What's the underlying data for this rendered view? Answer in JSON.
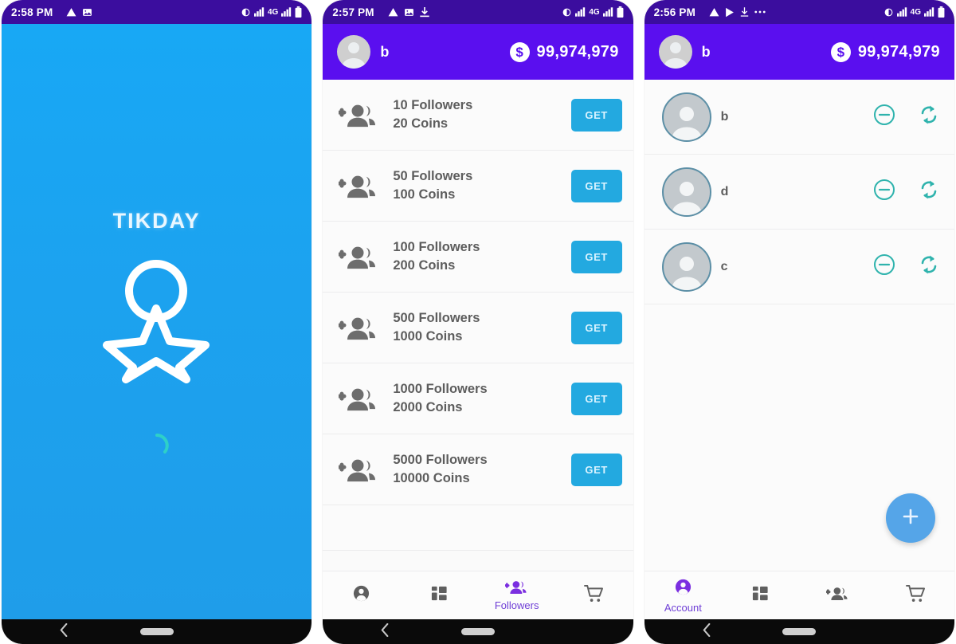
{
  "phones": [
    {
      "id": "splash",
      "statusbar": {
        "time": "2:58 PM",
        "left_icons": [
          "warning-icon",
          "image-icon"
        ],
        "right_icons": [
          "vibrate-icon",
          "signal-icon",
          "signal-icon-2",
          "battery-icon"
        ],
        "network": "4G"
      },
      "splash": {
        "title": "TIKDAY",
        "logo": "star-medal-logo",
        "spinner": "loading-spinner",
        "bg_color": "#1ca2ef",
        "spinner_color": "#2ed0c8"
      }
    },
    {
      "id": "store",
      "statusbar": {
        "time": "2:57 PM",
        "left_icons": [
          "warning-icon",
          "image-icon",
          "download-icon"
        ],
        "right_icons": [
          "vibrate-icon",
          "signal-icon",
          "signal-icon-2",
          "battery-icon"
        ],
        "network": "4G"
      },
      "appbar": {
        "avatar": "user-avatar",
        "username": "b",
        "coin_symbol": "$",
        "coin_balance": "99,974,979",
        "bg_color": "#5a0fef"
      },
      "store_items": [
        {
          "followers": "10 Followers",
          "coins": "20 Coins",
          "action": "GET"
        },
        {
          "followers": "50 Followers",
          "coins": "100 Coins",
          "action": "GET"
        },
        {
          "followers": "100 Followers",
          "coins": "200 Coins",
          "action": "GET"
        },
        {
          "followers": "500 Followers",
          "coins": "1000 Coins",
          "action": "GET"
        },
        {
          "followers": "1000 Followers",
          "coins": "2000 Coins",
          "action": "GET"
        },
        {
          "followers": "5000 Followers",
          "coins": "10000 Coins",
          "action": "GET"
        }
      ],
      "tabs": [
        {
          "icon": "account-icon",
          "label": "",
          "active": false
        },
        {
          "icon": "dashboard-icon",
          "label": "",
          "active": false
        },
        {
          "icon": "followers-icon",
          "label": "Followers",
          "active": true
        },
        {
          "icon": "cart-icon",
          "label": "",
          "active": false
        }
      ]
    },
    {
      "id": "accounts",
      "statusbar": {
        "time": "2:56 PM",
        "left_icons": [
          "warning-icon",
          "play-icon",
          "download-icon",
          "more-icon"
        ],
        "right_icons": [
          "vibrate-icon",
          "signal-icon",
          "signal-icon-2",
          "battery-icon"
        ],
        "network": "4G"
      },
      "appbar": {
        "avatar": "user-avatar",
        "username": "b",
        "coin_symbol": "$",
        "coin_balance": "99,974,979",
        "bg_color": "#5a0fef"
      },
      "accounts": [
        {
          "name": "b",
          "remove": "remove-icon",
          "refresh": "refresh-icon"
        },
        {
          "name": "d",
          "remove": "remove-icon",
          "refresh": "refresh-icon"
        },
        {
          "name": "c",
          "remove": "remove-icon",
          "refresh": "refresh-icon"
        }
      ],
      "fab": {
        "icon": "plus-icon",
        "color": "#55a5e8"
      },
      "tabs": [
        {
          "icon": "account-icon",
          "label": "Account",
          "active": true
        },
        {
          "icon": "dashboard-icon",
          "label": "",
          "active": false
        },
        {
          "icon": "followers-icon",
          "label": "",
          "active": false
        },
        {
          "icon": "cart-icon",
          "label": "",
          "active": false
        }
      ]
    }
  ],
  "navbar": {
    "back": "back-chevron-icon",
    "home": "home-pill-indicator"
  }
}
